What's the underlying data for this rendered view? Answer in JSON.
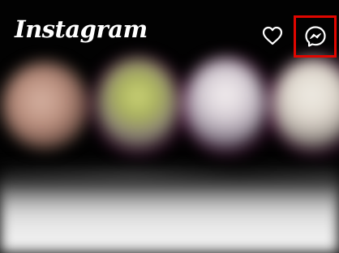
{
  "header": {
    "logo_text": "Instagram",
    "notifications_icon": "heart-icon",
    "messages_icon": "messenger-icon"
  },
  "colors": {
    "highlight_box": "#e10600",
    "background": "#020202",
    "icon": "#ffffff"
  },
  "stories": {
    "count_visible": 4
  }
}
